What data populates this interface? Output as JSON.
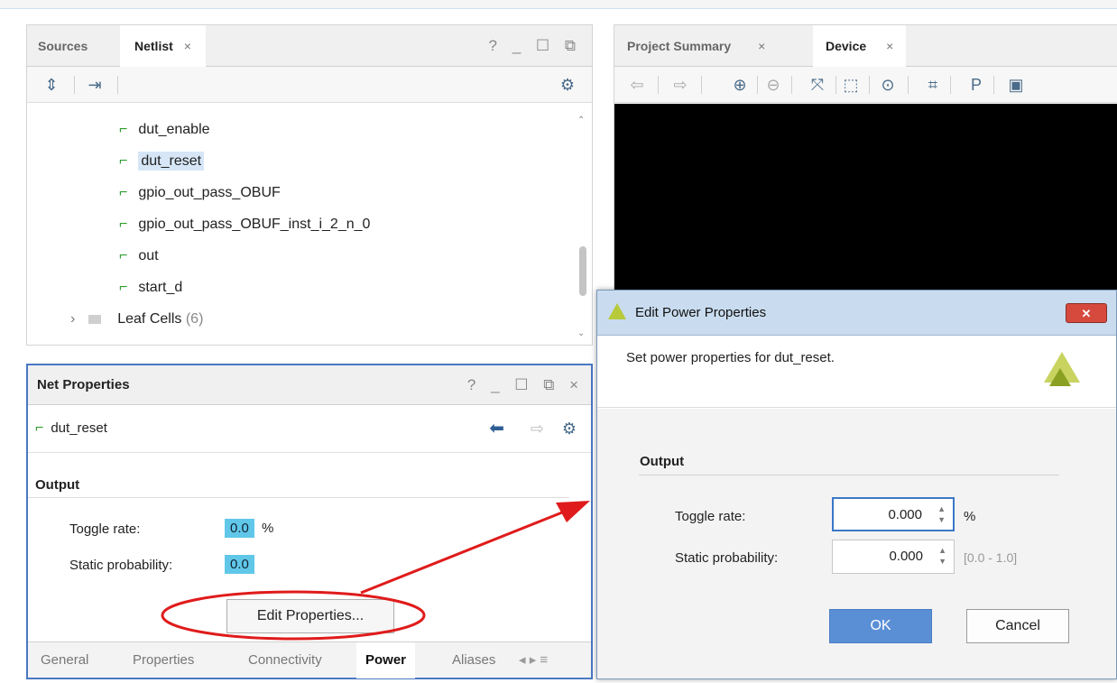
{
  "sources_panel": {
    "tabs": [
      "Sources",
      "Netlist"
    ],
    "active_tab": "Netlist",
    "close_glyph": "×",
    "controls": "? _ ☐ ⧉",
    "toolbar": {
      "collapse_icon": "collapse-all-icon",
      "expand_icon": "expand-icon",
      "settings_icon": "gear-icon"
    },
    "nets": [
      "dut_enable",
      "dut_reset",
      "gpio_out_pass_OBUF",
      "gpio_out_pass_OBUF_inst_i_2_n_0",
      "out",
      "start_d"
    ],
    "selected_net": "dut_reset",
    "leaf_cells_label": "Leaf Cells",
    "leaf_cells_count": "(6)"
  },
  "device_panel": {
    "tabs": [
      "Project Summary",
      "Device"
    ],
    "active_tab": "Device",
    "close_glyph": "×",
    "toolbar_icons": [
      "back-icon",
      "forward-icon",
      "zoom-in-icon",
      "zoom-out-icon",
      "fit-icon",
      "zoom-area-icon",
      "center-icon",
      "routing-icon",
      "pblock-icon",
      "device-view-icon"
    ]
  },
  "net_properties": {
    "title": "Net Properties",
    "controls": "? _ ☐ ⧉ ×",
    "net_name": "dut_reset",
    "section": "Output",
    "toggle_rate_label": "Toggle rate:",
    "toggle_rate_value": "0.0",
    "toggle_rate_unit": "%",
    "static_prob_label": "Static probability:",
    "static_prob_value": "0.0",
    "edit_button": "Edit Properties...",
    "bottom_tabs": [
      "General",
      "Properties",
      "Connectivity",
      "Power",
      "Aliases"
    ],
    "active_bottom_tab": "Power",
    "bottom_nav": "◂ ▸ ≡"
  },
  "dialog": {
    "title": "Edit Power Properties",
    "close_glyph": "✕",
    "description": "Set power properties for dut_reset.",
    "section": "Output",
    "toggle_rate_label": "Toggle rate:",
    "toggle_rate_value": "0.000",
    "toggle_rate_unit": "%",
    "static_prob_label": "Static probability:",
    "static_prob_value": "0.000",
    "static_prob_range": "[0.0 - 1.0]",
    "ok_label": "OK",
    "cancel_label": "Cancel"
  },
  "colors": {
    "accent_blue": "#5a8fd6",
    "annotation_red": "#e01b1b",
    "signal_green": "#2e9d2e",
    "value_highlight": "#60c7e9"
  }
}
